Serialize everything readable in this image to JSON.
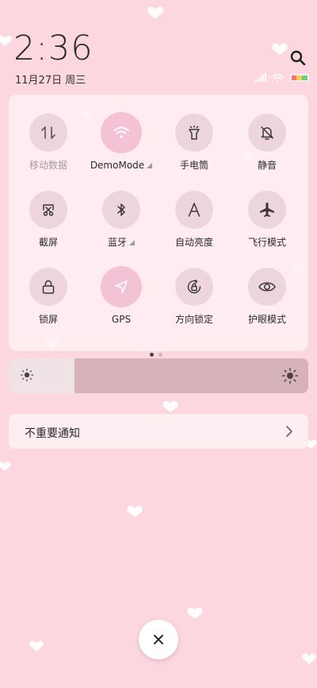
{
  "clock": {
    "time": "2:36",
    "date": "11月27日 周三"
  },
  "header": {
    "search_icon": "search-icon"
  },
  "status_bar": {
    "icons": [
      "signal-icon",
      "wifi-icon",
      "battery-icon"
    ]
  },
  "quick_settings": [
    {
      "id": "mobile-data",
      "label": "移动数据",
      "icon": "mobile-data-icon",
      "active": false,
      "dim": true,
      "expandable": false
    },
    {
      "id": "wifi",
      "label": "DemoMode",
      "icon": "wifi-icon",
      "active": true,
      "dim": false,
      "expandable": true
    },
    {
      "id": "flashlight",
      "label": "手电筒",
      "icon": "flashlight-icon",
      "active": false,
      "dim": false,
      "expandable": false
    },
    {
      "id": "mute",
      "label": "静音",
      "icon": "bell-off-icon",
      "active": false,
      "dim": false,
      "expandable": false
    },
    {
      "id": "screenshot",
      "label": "截屏",
      "icon": "screenshot-icon",
      "active": false,
      "dim": false,
      "expandable": false
    },
    {
      "id": "bluetooth",
      "label": "蓝牙",
      "icon": "bluetooth-icon",
      "active": false,
      "dim": false,
      "expandable": true
    },
    {
      "id": "auto-brightness",
      "label": "自动亮度",
      "icon": "auto-brightness-icon",
      "active": false,
      "dim": false,
      "expandable": false
    },
    {
      "id": "airplane",
      "label": "飞行模式",
      "icon": "airplane-icon",
      "active": false,
      "dim": false,
      "expandable": false
    },
    {
      "id": "lock-screen",
      "label": "锁屏",
      "icon": "lock-icon",
      "active": false,
      "dim": false,
      "expandable": false
    },
    {
      "id": "gps",
      "label": "GPS",
      "icon": "location-arrow-icon",
      "active": true,
      "dim": false,
      "expandable": false
    },
    {
      "id": "rotation-lock",
      "label": "方向锁定",
      "icon": "rotation-lock-icon",
      "active": false,
      "dim": false,
      "expandable": false
    },
    {
      "id": "eye-care",
      "label": "护眼模式",
      "icon": "eye-icon",
      "active": false,
      "dim": false,
      "expandable": false
    }
  ],
  "page_indicator": {
    "count": 2,
    "current": 0
  },
  "brightness": {
    "level": 0.22
  },
  "notification_bar": {
    "label": "不重要通知",
    "icon": "chevron-right-icon"
  },
  "close_button": {
    "icon": "close-icon"
  },
  "colors": {
    "background": "#fcd7e0",
    "active_tile": "#f3c2d5",
    "inactive_tile": "#ecd6db",
    "slider_track": "#d6b3bb",
    "slider_fill": "#efe3e6"
  }
}
